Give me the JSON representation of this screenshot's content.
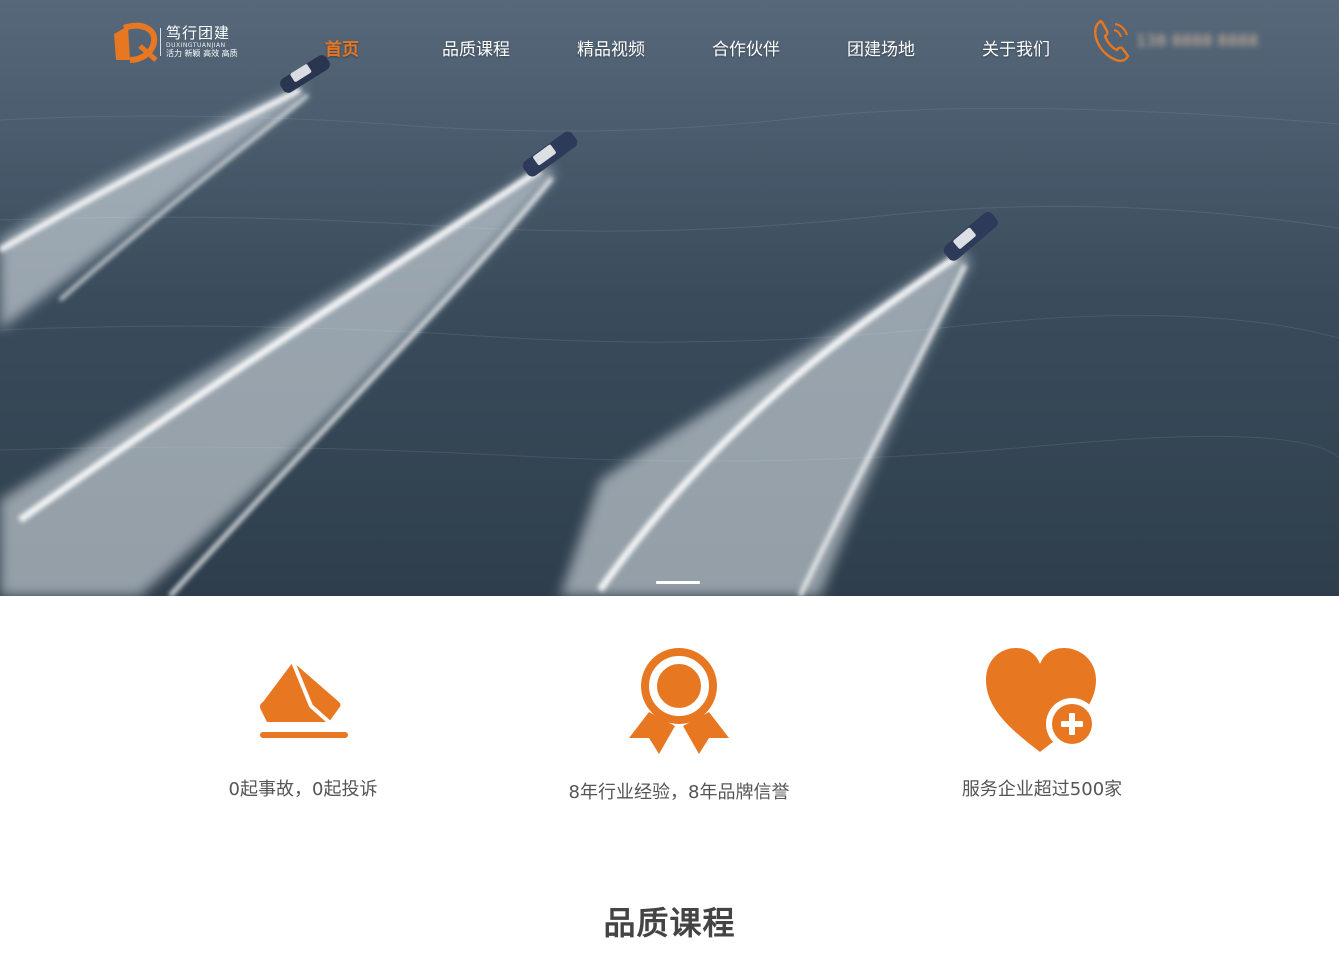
{
  "brand": {
    "name": "笃行团建",
    "pinyin": "DUXINGTUANJIAN",
    "slogan": "活力 新颖 高效 高质"
  },
  "nav": {
    "items": [
      {
        "label": "首页",
        "active": true
      },
      {
        "label": "品质课程",
        "active": false
      },
      {
        "label": "精品视频",
        "active": false
      },
      {
        "label": "合作伙伴",
        "active": false
      },
      {
        "label": "团建场地",
        "active": false
      },
      {
        "label": "关于我们",
        "active": false
      }
    ]
  },
  "contact": {
    "icon": "phone-icon",
    "phone": "138 8888 8888"
  },
  "hero": {
    "image": "speedboats-aerial-photo",
    "slide_current": 1,
    "slide_total": 1
  },
  "features": [
    {
      "icon": "envelope-shield-icon",
      "text": "0起事故，0起投诉"
    },
    {
      "icon": "award-medal-icon",
      "text": "8年行业经验，8年品牌信誉"
    },
    {
      "icon": "heart-plus-icon",
      "text": "服务企业超过500家"
    }
  ],
  "sections": {
    "courses_title": "品质课程"
  },
  "colors": {
    "accent": "#e87722",
    "text": "#555555",
    "title": "#444444"
  }
}
